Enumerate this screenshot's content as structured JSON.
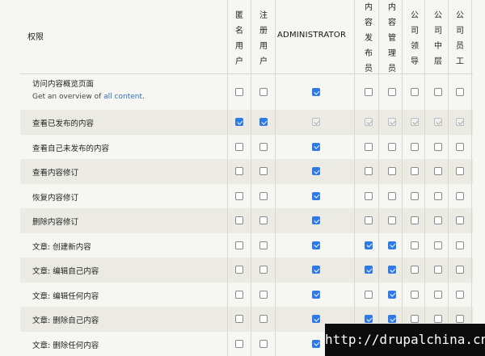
{
  "header": {
    "permission": "权限",
    "roles": [
      {
        "id": "anon",
        "chars": [
          "匿",
          "名",
          "用",
          "户"
        ]
      },
      {
        "id": "auth",
        "chars": [
          "注",
          "册",
          "用",
          "户"
        ]
      },
      {
        "id": "admin",
        "label": "ADMINISTRATOR"
      },
      {
        "id": "publisher",
        "chars": [
          "内",
          "容",
          "发",
          "布",
          "员"
        ]
      },
      {
        "id": "manager",
        "chars": [
          "内",
          "容",
          "管",
          "理",
          "员"
        ]
      },
      {
        "id": "leader",
        "chars": [
          "公",
          "司",
          "领",
          "导"
        ]
      },
      {
        "id": "middle",
        "chars": [
          "公",
          "司",
          "中",
          "层"
        ]
      },
      {
        "id": "staff",
        "chars": [
          "公",
          "司",
          "员",
          "工"
        ]
      }
    ]
  },
  "rows": [
    {
      "label": "访问内容概览页面",
      "desc_prefix": "Get an overview of ",
      "desc_link": "all content",
      "desc_suffix": ".",
      "states": [
        "off",
        "off",
        "on",
        "off",
        "off",
        "off",
        "off",
        "off"
      ]
    },
    {
      "label": "查看已发布的内容",
      "states": [
        "on",
        "on",
        "dis",
        "dis",
        "dis",
        "dis",
        "dis",
        "dis"
      ]
    },
    {
      "label": "查看自己未发布的内容",
      "states": [
        "off",
        "off",
        "on",
        "off",
        "off",
        "off",
        "off",
        "off"
      ]
    },
    {
      "label": "查看内容修订",
      "states": [
        "off",
        "off",
        "on",
        "off",
        "off",
        "off",
        "off",
        "off"
      ]
    },
    {
      "label": "恢复内容修订",
      "states": [
        "off",
        "off",
        "on",
        "off",
        "off",
        "off",
        "off",
        "off"
      ]
    },
    {
      "label": "删除内容修订",
      "states": [
        "off",
        "off",
        "on",
        "off",
        "off",
        "off",
        "off",
        "off"
      ]
    },
    {
      "label": "文章: 创建新内容",
      "states": [
        "off",
        "off",
        "on",
        "on",
        "on",
        "off",
        "off",
        "off"
      ]
    },
    {
      "label": "文章: 编辑自己内容",
      "states": [
        "off",
        "off",
        "on",
        "on",
        "on",
        "off",
        "off",
        "off"
      ]
    },
    {
      "label": "文章: 编辑任何内容",
      "states": [
        "off",
        "off",
        "on",
        "off",
        "on",
        "off",
        "off",
        "off"
      ]
    },
    {
      "label": "文章: 删除自己内容",
      "states": [
        "off",
        "off",
        "on",
        "on",
        "on",
        "off",
        "off",
        "off"
      ]
    },
    {
      "label": "文章: 删除任何内容",
      "states": [
        "off",
        "off",
        "on",
        "off",
        "off",
        "off",
        "off",
        "off"
      ]
    }
  ],
  "watermark": "http://drupalchina.cn"
}
